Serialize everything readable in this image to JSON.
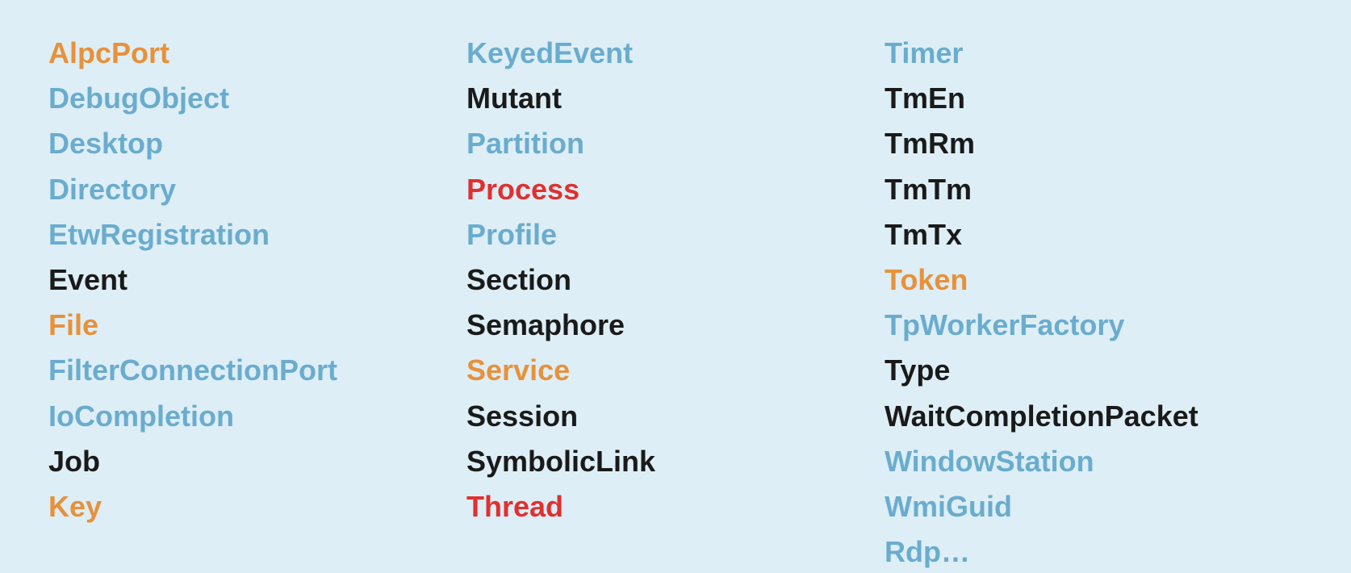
{
  "columns": [
    {
      "id": "col1",
      "items": [
        {
          "label": "AlpcPort",
          "color": "orange"
        },
        {
          "label": "DebugObject",
          "color": "blue"
        },
        {
          "label": "Desktop",
          "color": "blue"
        },
        {
          "label": "Directory",
          "color": "blue"
        },
        {
          "label": "EtwRegistration",
          "color": "blue"
        },
        {
          "label": "Event",
          "color": "black"
        },
        {
          "label": "File",
          "color": "orange"
        },
        {
          "label": "FilterConnectionPort",
          "color": "blue"
        },
        {
          "label": "IoCompletion",
          "color": "blue"
        },
        {
          "label": "Job",
          "color": "black"
        },
        {
          "label": "Key",
          "color": "orange"
        }
      ]
    },
    {
      "id": "col2",
      "items": [
        {
          "label": "KeyedEvent",
          "color": "blue"
        },
        {
          "label": "Mutant",
          "color": "black"
        },
        {
          "label": "Partition",
          "color": "blue"
        },
        {
          "label": "Process",
          "color": "red"
        },
        {
          "label": "Profile",
          "color": "blue"
        },
        {
          "label": "Section",
          "color": "black"
        },
        {
          "label": "Semaphore",
          "color": "black"
        },
        {
          "label": "Service",
          "color": "orange"
        },
        {
          "label": "Session",
          "color": "black"
        },
        {
          "label": "SymbolicLink",
          "color": "black"
        },
        {
          "label": "Thread",
          "color": "red"
        }
      ]
    },
    {
      "id": "col3",
      "items": [
        {
          "label": "Timer",
          "color": "blue"
        },
        {
          "label": "TmEn",
          "color": "black"
        },
        {
          "label": "TmRm",
          "color": "black"
        },
        {
          "label": "TmTm",
          "color": "black"
        },
        {
          "label": "TmTx",
          "color": "black"
        },
        {
          "label": "Token",
          "color": "orange"
        },
        {
          "label": "TpWorkerFactory",
          "color": "blue"
        },
        {
          "label": "Type",
          "color": "black"
        },
        {
          "label": "WaitCompletionPacket",
          "color": "black"
        },
        {
          "label": "WindowStation",
          "color": "blue"
        },
        {
          "label": "WmiGuid",
          "color": "blue"
        },
        {
          "label": "Rdp…",
          "color": "blue"
        }
      ]
    }
  ],
  "colors": {
    "orange": "#e8913a",
    "blue": "#6aacce",
    "black": "#1a1a1a",
    "red": "#e03030"
  }
}
